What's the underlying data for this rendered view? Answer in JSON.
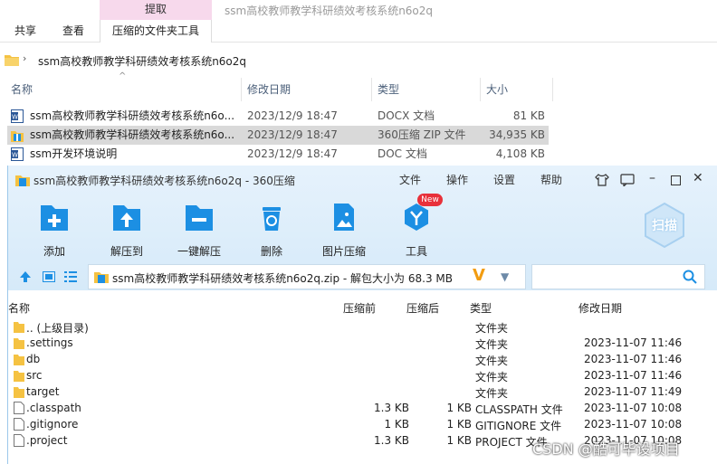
{
  "ribbon": {
    "context_group": "提取",
    "window_title": "ssm高校教师教学科研绩效考核系统n6o2q",
    "tabs": [
      "共享",
      "查看",
      "压缩的文件夹工具"
    ]
  },
  "address": {
    "path": "ssm高校教师教学科研绩效考核系统n6o2q"
  },
  "explorer": {
    "columns": [
      "名称",
      "修改日期",
      "类型",
      "大小"
    ],
    "rows": [
      {
        "name": "ssm高校教师教学科研绩效考核系统n6o...",
        "date": "2023/12/9 18:47",
        "type": "DOCX 文档",
        "size": "81 KB",
        "icon": "word-doc-icon"
      },
      {
        "name": "ssm高校教师教学科研绩效考核系统n6o...",
        "date": "2023/12/9 18:47",
        "type": "360压缩 ZIP 文件",
        "size": "34,935 KB",
        "icon": "zip-archive-icon"
      },
      {
        "name": "ssm开发环境说明",
        "date": "2023/12/9 18:47",
        "type": "DOC 文档",
        "size": "4,108 KB",
        "icon": "word-doc-icon"
      }
    ]
  },
  "zip": {
    "title": "ssm高校教师教学科研绩效考核系统n6o2q - 360压缩",
    "menu": [
      "文件",
      "操作",
      "设置",
      "帮助"
    ],
    "tools": [
      "添加",
      "解压到",
      "一键解压",
      "删除",
      "图片压缩",
      "工具"
    ],
    "new_badge": "New",
    "scan_label": "扫描",
    "path_text": "ssm高校教师教学科研绩效考核系统n6o2q.zip - 解包大小为 68.3 MB",
    "columns": [
      "名称",
      "压缩前",
      "压缩后",
      "类型",
      "修改日期"
    ],
    "rows": [
      {
        "name": ".. (上级目录)",
        "before": "",
        "after": "",
        "type": "文件夹",
        "date": ""
      },
      {
        "name": ".settings",
        "before": "",
        "after": "",
        "type": "文件夹",
        "date": "2023-11-07 11:46"
      },
      {
        "name": "db",
        "before": "",
        "after": "",
        "type": "文件夹",
        "date": "2023-11-07 11:46"
      },
      {
        "name": "src",
        "before": "",
        "after": "",
        "type": "文件夹",
        "date": "2023-11-07 11:46"
      },
      {
        "name": "target",
        "before": "",
        "after": "",
        "type": "文件夹",
        "date": "2023-11-07 11:49"
      },
      {
        "name": ".classpath",
        "before": "1.3 KB",
        "after": "1 KB",
        "type": "CLASSPATH 文件",
        "date": "2023-11-07 10:08"
      },
      {
        "name": ".gitignore",
        "before": "1 KB",
        "after": "1 KB",
        "type": "GITIGNORE 文件",
        "date": "2023-11-07 10:08"
      },
      {
        "name": ".project",
        "before": "1.3 KB",
        "after": "1 KB",
        "type": "PROJECT 文件",
        "date": "2023-11-07 10:08"
      }
    ]
  },
  "watermark": "CSDN @酷可毕设项目",
  "colors": {
    "accent": "#1c8fe3",
    "folder": "#f5c242",
    "selection": "#d9d9d9",
    "badge": "#e8303a"
  }
}
